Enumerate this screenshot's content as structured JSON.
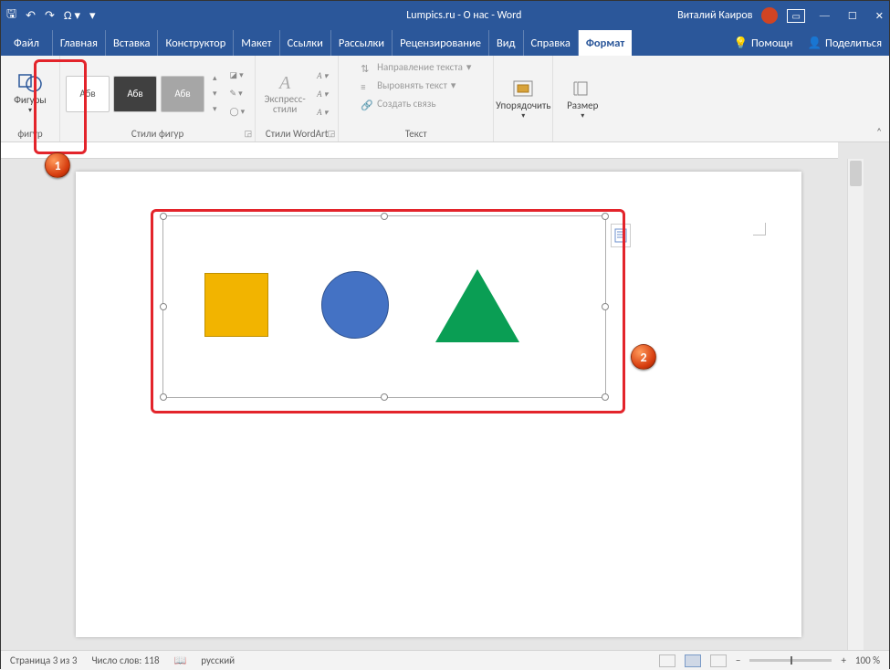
{
  "titlebar": {
    "doc_title": "Lumpics.ru - О нас - Word",
    "user_name": "Виталий Каиров"
  },
  "tabs": {
    "file": "Файл",
    "items": [
      "Главная",
      "Вставка",
      "Конструктор",
      "Макет",
      "Ссылки",
      "Рассылки",
      "Рецензирование",
      "Вид",
      "Справка"
    ],
    "active": "Формат",
    "help": "Помощн",
    "share": "Поделиться"
  },
  "ribbon": {
    "shapes_btn": "Фигуры",
    "insert_group": "фигур",
    "style_sample": "Абв",
    "styles_group": "Стили фигур",
    "wordart_btn": "Экспресс-стили",
    "wordart_group": "Стили WordArt",
    "text_dir": "Направление текста",
    "text_align": "Выровнять текст",
    "text_link": "Создать связь",
    "text_group": "Текст",
    "arrange_btn": "Упорядочить",
    "size_btn": "Размер"
  },
  "status": {
    "page": "Страница 3 из 3",
    "words": "Число слов: 118",
    "lang": "русский",
    "zoom": "100 %"
  },
  "markers": {
    "m1": "1",
    "m2": "2"
  }
}
